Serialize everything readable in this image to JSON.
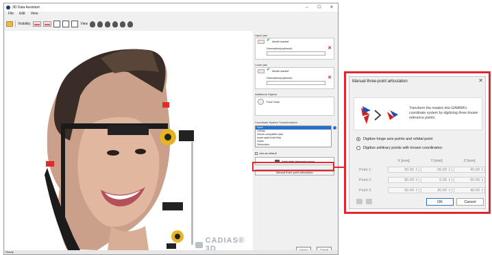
{
  "app": {
    "title": "3D Data Assistant",
    "menu": [
      "File",
      "Edit",
      "View"
    ],
    "toolbar": {
      "visibility_label": "Visibility:",
      "view_label": "View"
    },
    "status": "Ready"
  },
  "watermark": {
    "text": "CADIAS® 3D"
  },
  "panel": {
    "upper_jaw": {
      "label": "Upper jaw",
      "status": "Model loaded",
      "description_label": "Description(optional):"
    },
    "lower_jaw": {
      "label": "Lower jaw",
      "status": "Model loaded",
      "description_label": "Description(optional):"
    },
    "additional_objects": {
      "label": "Additional Objects",
      "item": "Face Scan"
    },
    "coordinate_system": {
      "label": "Coordinate System Transformation",
      "options": [
        "None",
        "CADiax",
        "Zeuner-compatible data",
        "smart splint Artic/Vinyl",
        "Gamo",
        "Zebris/arho"
      ],
      "selected_index": 0
    },
    "use_default": "Use as default",
    "articulate_button": "Articulate intraoral scans",
    "manual_button": "Manual three-point articulation",
    "import_button": "Import",
    "cancel_button": "Cancel"
  },
  "dialog": {
    "title": "Manual three-point articulation",
    "description": "Transform the models into GAMMA's coordinate system by digitizing three known reference points.",
    "option_hinge": "Digitize hinge axis points and orbital point",
    "option_arbitrary": "Digitize arbitrary points with known coordinates:",
    "columns": [
      "X [mm]",
      "Y [mm]",
      "Z [mm]"
    ],
    "points": [
      {
        "label": "Point 1:",
        "values": [
          "50.00",
          "-30.00",
          "40.00"
        ]
      },
      {
        "label": "Point 2:",
        "values": [
          "80.00",
          "0.00",
          "50.00"
        ]
      },
      {
        "label": "Point 3:",
        "values": [
          "50.00",
          "30.00",
          "40.00"
        ]
      }
    ],
    "ok": "OK",
    "cancel": "Cancel"
  },
  "colors": {
    "highlight": "#e0262e",
    "accent": "#2a6fc9",
    "check": "#2e9e2e"
  }
}
